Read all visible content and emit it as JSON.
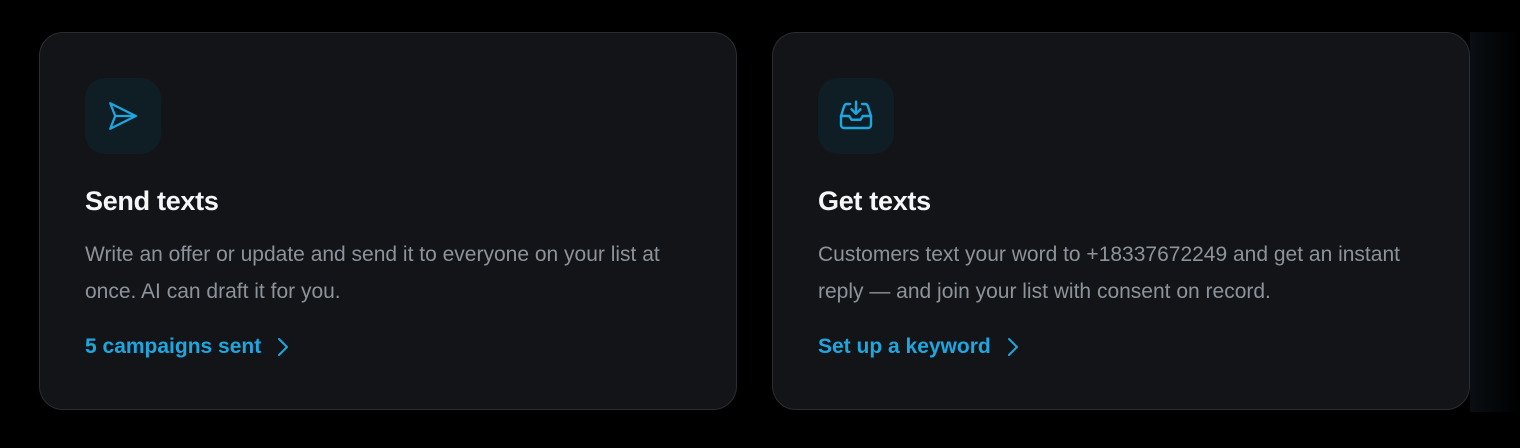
{
  "colors": {
    "background": "#000000",
    "card_background": "#121417",
    "card_border": "#2a2d31",
    "accent": "#1ea6df",
    "title": "#f5f6f7",
    "body_text": "#8d939b",
    "icon_tile": "#0f1d25"
  },
  "cards": [
    {
      "icon": "send-icon",
      "title": "Send texts",
      "description": "Write an offer or update and send it to everyone on your list at once. AI can draft it for you.",
      "link_label": "5 campaigns sent",
      "link_icon": "chevron-right-icon"
    },
    {
      "icon": "inbox-download-icon",
      "title": "Get texts",
      "description": "Customers text your word to +18337672249 and get an instant reply — and join your list with consent on record.",
      "link_label": "Set up a keyword",
      "link_icon": "chevron-right-icon"
    }
  ]
}
